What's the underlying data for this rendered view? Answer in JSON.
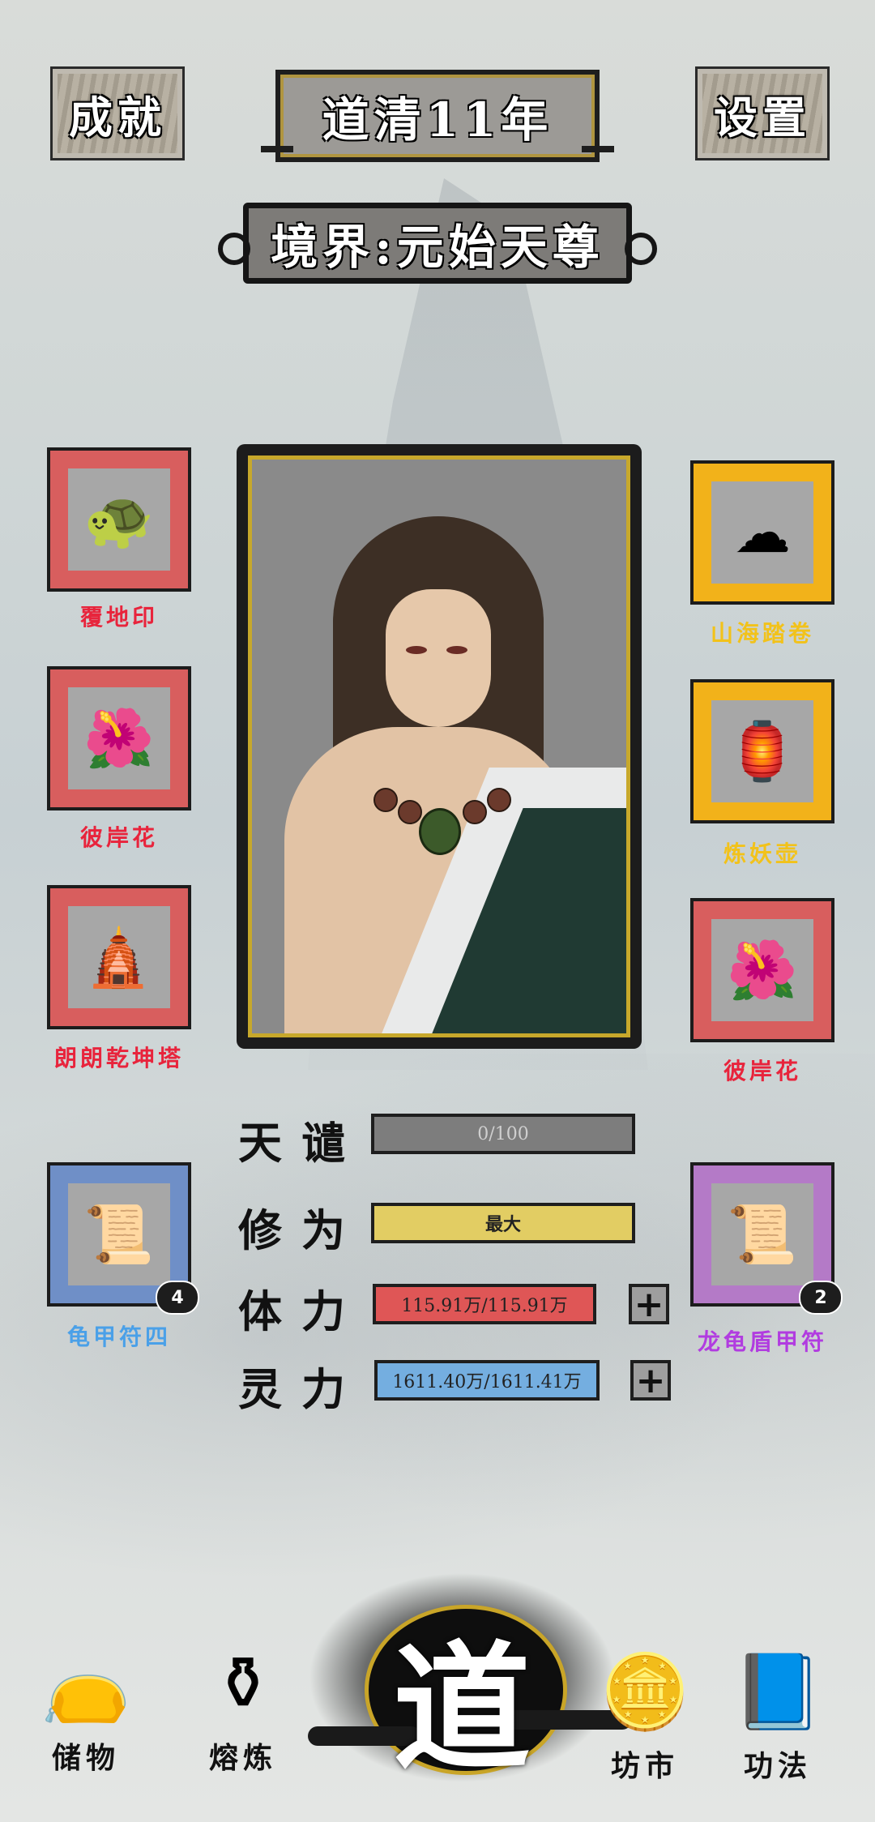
{
  "header": {
    "achievements_label": "成就",
    "year_label": "道清11年",
    "settings_label": "设置",
    "realm_label": "境界:元始天尊"
  },
  "left_slots": [
    {
      "label": "覆地印",
      "label_color": "#e8243c",
      "frame": "red",
      "icon": "turtle-seal-icon"
    },
    {
      "label": "彼岸花",
      "label_color": "#e8243c",
      "frame": "red",
      "icon": "spider-lily-icon"
    },
    {
      "label": "朗朗乾坤塔",
      "label_color": "#e8243c",
      "frame": "red",
      "icon": "pagoda-icon"
    },
    {
      "label": "龟甲符四",
      "label_color": "#4aa0e8",
      "frame": "blue",
      "icon": "talisman-icon",
      "count": "4"
    }
  ],
  "right_slots": [
    {
      "label": "山海踏卷",
      "label_color": "#f2c21a",
      "frame": "gold",
      "icon": "scroll-cloud-icon"
    },
    {
      "label": "炼妖壶",
      "label_color": "#f2c21a",
      "frame": "gold",
      "icon": "pot-icon"
    },
    {
      "label": "彼岸花",
      "label_color": "#e8243c",
      "frame": "red",
      "icon": "spider-lily-icon"
    },
    {
      "label": "龙龟盾甲符",
      "label_color": "#b13ce0",
      "frame": "purple",
      "icon": "talisman-icon",
      "count": "2"
    }
  ],
  "stats": {
    "tribulation_label": "天谴",
    "tribulation_value": "0/100",
    "cultivation_label": "修为",
    "cultivation_value": "最大",
    "stamina_label": "体力",
    "stamina_value": "115.91万/115.91万",
    "spirit_label": "灵力",
    "spirit_value": "1611.40万/1611.41万"
  },
  "nav": {
    "storage_label": "储物",
    "smelt_label": "熔炼",
    "dao_label": "道",
    "market_label": "坊市",
    "skills_label": "功法"
  }
}
